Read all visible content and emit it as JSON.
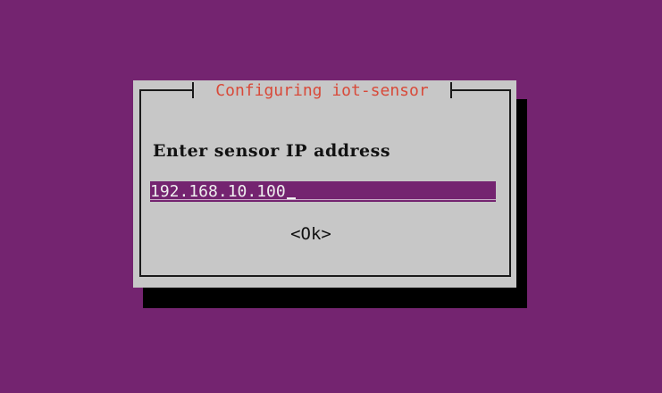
{
  "dialog": {
    "title": "Configuring iot-sensor",
    "prompt": "Enter sensor IP address",
    "ip_value": "192.168.10.100",
    "ok_label": "<Ok>"
  },
  "colors": {
    "background": "#742470",
    "dialog_background": "#c7c7c7",
    "title_color": "#d84a3a",
    "input_background": "#742470",
    "input_text": "#eeeeee",
    "shadow": "#000000"
  }
}
